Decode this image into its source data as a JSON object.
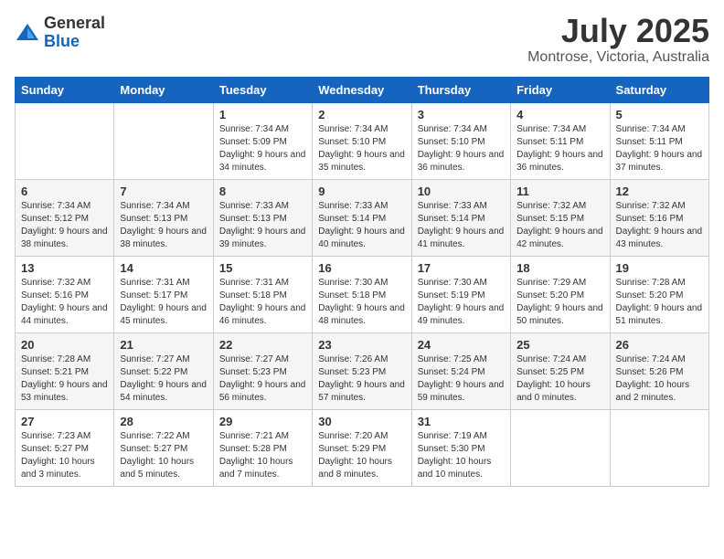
{
  "logo": {
    "general": "General",
    "blue": "Blue"
  },
  "title": {
    "month_year": "July 2025",
    "location": "Montrose, Victoria, Australia"
  },
  "weekdays": [
    "Sunday",
    "Monday",
    "Tuesday",
    "Wednesday",
    "Thursday",
    "Friday",
    "Saturday"
  ],
  "weeks": [
    [
      {
        "day": "",
        "info": ""
      },
      {
        "day": "",
        "info": ""
      },
      {
        "day": "1",
        "info": "Sunrise: 7:34 AM\nSunset: 5:09 PM\nDaylight: 9 hours\nand 34 minutes."
      },
      {
        "day": "2",
        "info": "Sunrise: 7:34 AM\nSunset: 5:10 PM\nDaylight: 9 hours\nand 35 minutes."
      },
      {
        "day": "3",
        "info": "Sunrise: 7:34 AM\nSunset: 5:10 PM\nDaylight: 9 hours\nand 36 minutes."
      },
      {
        "day": "4",
        "info": "Sunrise: 7:34 AM\nSunset: 5:11 PM\nDaylight: 9 hours\nand 36 minutes."
      },
      {
        "day": "5",
        "info": "Sunrise: 7:34 AM\nSunset: 5:11 PM\nDaylight: 9 hours\nand 37 minutes."
      }
    ],
    [
      {
        "day": "6",
        "info": "Sunrise: 7:34 AM\nSunset: 5:12 PM\nDaylight: 9 hours\nand 38 minutes."
      },
      {
        "day": "7",
        "info": "Sunrise: 7:34 AM\nSunset: 5:13 PM\nDaylight: 9 hours\nand 38 minutes."
      },
      {
        "day": "8",
        "info": "Sunrise: 7:33 AM\nSunset: 5:13 PM\nDaylight: 9 hours\nand 39 minutes."
      },
      {
        "day": "9",
        "info": "Sunrise: 7:33 AM\nSunset: 5:14 PM\nDaylight: 9 hours\nand 40 minutes."
      },
      {
        "day": "10",
        "info": "Sunrise: 7:33 AM\nSunset: 5:14 PM\nDaylight: 9 hours\nand 41 minutes."
      },
      {
        "day": "11",
        "info": "Sunrise: 7:32 AM\nSunset: 5:15 PM\nDaylight: 9 hours\nand 42 minutes."
      },
      {
        "day": "12",
        "info": "Sunrise: 7:32 AM\nSunset: 5:16 PM\nDaylight: 9 hours\nand 43 minutes."
      }
    ],
    [
      {
        "day": "13",
        "info": "Sunrise: 7:32 AM\nSunset: 5:16 PM\nDaylight: 9 hours\nand 44 minutes."
      },
      {
        "day": "14",
        "info": "Sunrise: 7:31 AM\nSunset: 5:17 PM\nDaylight: 9 hours\nand 45 minutes."
      },
      {
        "day": "15",
        "info": "Sunrise: 7:31 AM\nSunset: 5:18 PM\nDaylight: 9 hours\nand 46 minutes."
      },
      {
        "day": "16",
        "info": "Sunrise: 7:30 AM\nSunset: 5:18 PM\nDaylight: 9 hours\nand 48 minutes."
      },
      {
        "day": "17",
        "info": "Sunrise: 7:30 AM\nSunset: 5:19 PM\nDaylight: 9 hours\nand 49 minutes."
      },
      {
        "day": "18",
        "info": "Sunrise: 7:29 AM\nSunset: 5:20 PM\nDaylight: 9 hours\nand 50 minutes."
      },
      {
        "day": "19",
        "info": "Sunrise: 7:28 AM\nSunset: 5:20 PM\nDaylight: 9 hours\nand 51 minutes."
      }
    ],
    [
      {
        "day": "20",
        "info": "Sunrise: 7:28 AM\nSunset: 5:21 PM\nDaylight: 9 hours\nand 53 minutes."
      },
      {
        "day": "21",
        "info": "Sunrise: 7:27 AM\nSunset: 5:22 PM\nDaylight: 9 hours\nand 54 minutes."
      },
      {
        "day": "22",
        "info": "Sunrise: 7:27 AM\nSunset: 5:23 PM\nDaylight: 9 hours\nand 56 minutes."
      },
      {
        "day": "23",
        "info": "Sunrise: 7:26 AM\nSunset: 5:23 PM\nDaylight: 9 hours\nand 57 minutes."
      },
      {
        "day": "24",
        "info": "Sunrise: 7:25 AM\nSunset: 5:24 PM\nDaylight: 9 hours\nand 59 minutes."
      },
      {
        "day": "25",
        "info": "Sunrise: 7:24 AM\nSunset: 5:25 PM\nDaylight: 10 hours\nand 0 minutes."
      },
      {
        "day": "26",
        "info": "Sunrise: 7:24 AM\nSunset: 5:26 PM\nDaylight: 10 hours\nand 2 minutes."
      }
    ],
    [
      {
        "day": "27",
        "info": "Sunrise: 7:23 AM\nSunset: 5:27 PM\nDaylight: 10 hours\nand 3 minutes."
      },
      {
        "day": "28",
        "info": "Sunrise: 7:22 AM\nSunset: 5:27 PM\nDaylight: 10 hours\nand 5 minutes."
      },
      {
        "day": "29",
        "info": "Sunrise: 7:21 AM\nSunset: 5:28 PM\nDaylight: 10 hours\nand 7 minutes."
      },
      {
        "day": "30",
        "info": "Sunrise: 7:20 AM\nSunset: 5:29 PM\nDaylight: 10 hours\nand 8 minutes."
      },
      {
        "day": "31",
        "info": "Sunrise: 7:19 AM\nSunset: 5:30 PM\nDaylight: 10 hours\nand 10 minutes."
      },
      {
        "day": "",
        "info": ""
      },
      {
        "day": "",
        "info": ""
      }
    ]
  ]
}
